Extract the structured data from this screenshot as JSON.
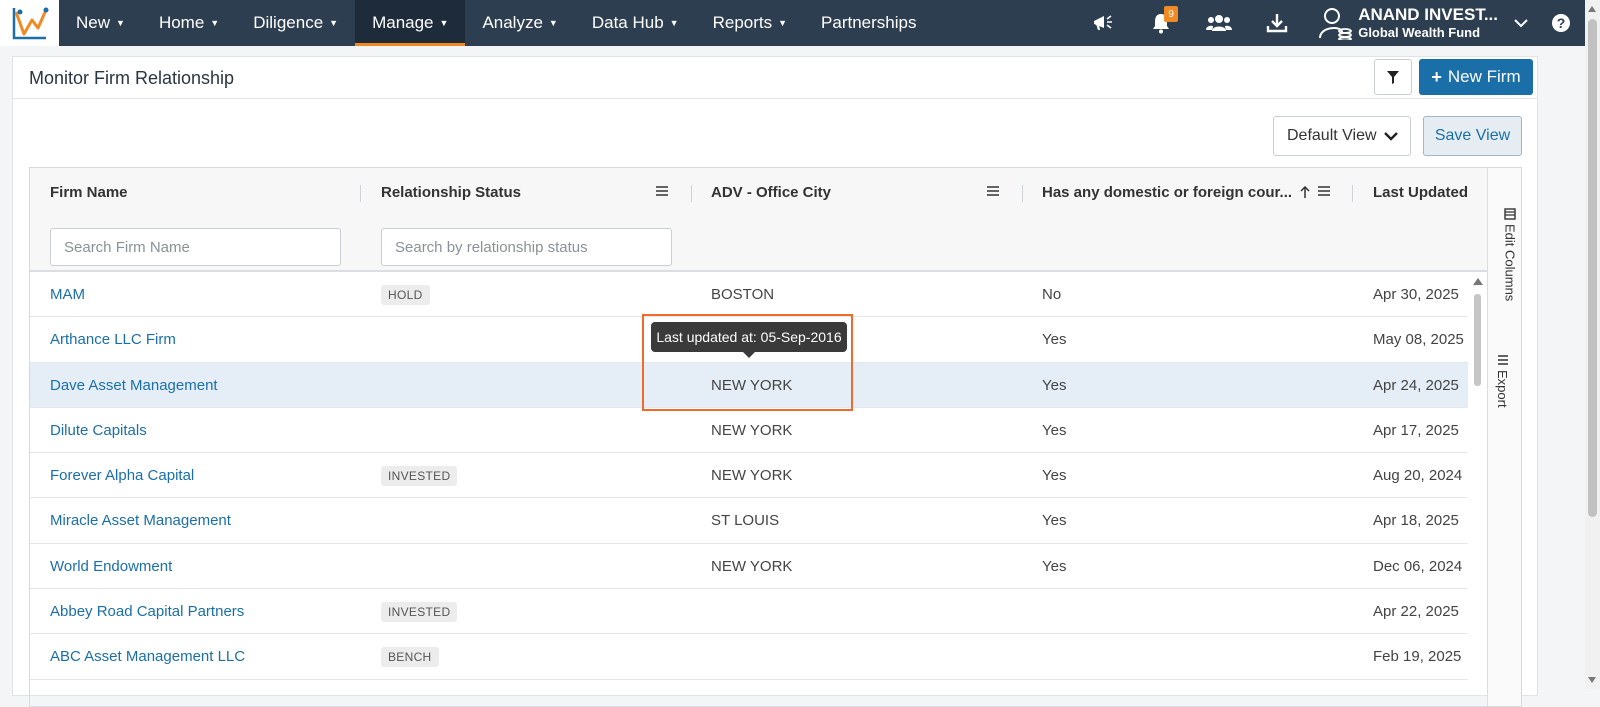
{
  "nav": {
    "items": [
      {
        "label": "New"
      },
      {
        "label": "Home"
      },
      {
        "label": "Diligence"
      },
      {
        "label": "Manage",
        "active": true
      },
      {
        "label": "Analyze"
      },
      {
        "label": "Data Hub"
      },
      {
        "label": "Reports"
      },
      {
        "label": "Partnerships"
      }
    ],
    "notification_count": "9",
    "user_name": "ANAND INVEST...",
    "user_fund": "Global Wealth Fund",
    "help": "?"
  },
  "page": {
    "title": "Monitor Firm Relationship",
    "new_firm_label": "New Firm",
    "default_view_label": "Default View",
    "save_view_label": "Save View"
  },
  "grid": {
    "columns": {
      "firm_name": "Firm Name",
      "relationship_status": "Relationship Status",
      "office_city": "ADV - Office City",
      "foreign_court": "Has any domestic or foreign cour...",
      "last_updated": "Last Updated"
    },
    "search": {
      "firm_placeholder": "Search Firm Name",
      "status_placeholder": "Search by relationship status"
    },
    "rows": [
      {
        "firm": "MAM",
        "status": "HOLD",
        "city": "BOSTON",
        "court": "No",
        "updated": "Apr 30, 2025"
      },
      {
        "firm": "Arthance LLC Firm",
        "status": "",
        "city": "",
        "court": "Yes",
        "updated": "May 08, 2025"
      },
      {
        "firm": "Dave Asset Management",
        "status": "",
        "city": "NEW YORK",
        "court": "Yes",
        "updated": "Apr 24, 2025"
      },
      {
        "firm": "Dilute Capitals",
        "status": "",
        "city": "NEW YORK",
        "court": "Yes",
        "updated": "Apr 17, 2025"
      },
      {
        "firm": "Forever Alpha Capital",
        "status": "INVESTED",
        "city": "NEW YORK",
        "court": "Yes",
        "updated": "Aug 20, 2024"
      },
      {
        "firm": "Miracle Asset Management",
        "status": "",
        "city": "ST LOUIS",
        "court": "Yes",
        "updated": "Apr 18, 2025"
      },
      {
        "firm": "World Endowment",
        "status": "",
        "city": "NEW YORK",
        "court": "Yes",
        "updated": "Dec 06, 2024"
      },
      {
        "firm": "Abbey Road Capital Partners",
        "status": "INVESTED",
        "city": "",
        "court": "",
        "updated": "Apr 22, 2025"
      },
      {
        "firm": "ABC Asset Management LLC",
        "status": "BENCH",
        "city": "",
        "court": "",
        "updated": "Feb 19, 2025"
      }
    ],
    "side_panel": {
      "edit_columns": "Edit Columns",
      "export": "Export"
    },
    "tooltip": "Last updated at: 05-Sep-2016"
  },
  "colors": {
    "nav_bg": "#2d3e50",
    "accent_orange": "#f08a24",
    "link_blue": "#1a6fa8",
    "highlight_row": "#e5eef7",
    "focus_border": "#ef6a2e"
  }
}
